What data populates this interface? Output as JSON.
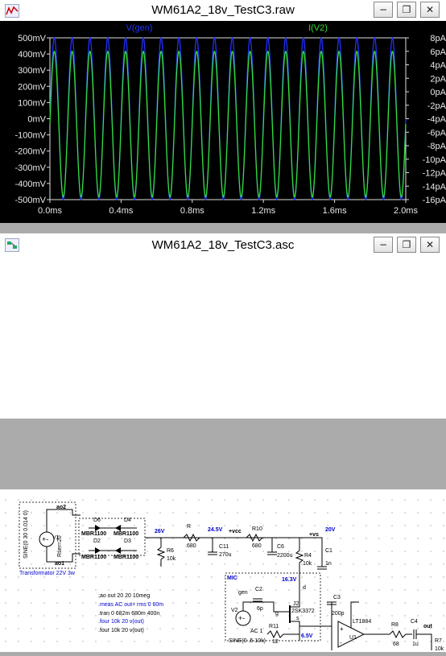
{
  "plot_window": {
    "title": "WM61A2_18v_TestC3.raw",
    "buttons": {
      "minimize": "−",
      "restore": "❐",
      "close": "✕"
    }
  },
  "chart_data": {
    "type": "line",
    "x": {
      "label": "time",
      "range": [
        0,
        2.0
      ],
      "ticks": [
        "0.0ms",
        "0.4ms",
        "0.8ms",
        "1.2ms",
        "1.6ms",
        "2.0ms"
      ]
    },
    "y_left": {
      "range": [
        -500,
        500
      ],
      "ticks": [
        "500mV",
        "400mV",
        "300mV",
        "200mV",
        "100mV",
        "0mV",
        "-100mV",
        "-200mV",
        "-300mV",
        "-400mV",
        "-500mV"
      ]
    },
    "y_right": {
      "range": [
        -16,
        8
      ],
      "ticks": [
        "8pA",
        "6pA",
        "4pA",
        "2pA",
        "0pA",
        "-2pA",
        "-4pA",
        "-6pA",
        "-8pA",
        "-10pA",
        "-12pA",
        "-14pA",
        "-16pA"
      ]
    },
    "series": [
      {
        "name": "V(gen)",
        "color": "#2030ff",
        "amplitude_mV": 500,
        "offset_mV": 0,
        "frequency_kHz": 10,
        "axis": "left"
      },
      {
        "name": "I(V2)",
        "color": "#33dd33",
        "amplitude_pA": 10.8,
        "offset_pA": -4.8,
        "frequency_kHz": 10,
        "axis": "right"
      }
    ],
    "grid": false,
    "background": "#000000"
  },
  "schem_window": {
    "title": "WM61A2_18v_TestC3.asc",
    "buttons": {
      "minimize": "−",
      "restore": "❐",
      "close": "✕"
    }
  },
  "schematic": {
    "transformer": {
      "name": "V1",
      "value": "SINE(0 30 0.014 0)",
      "param": "Rser=20",
      "nodes": [
        "ao2",
        "ao1"
      ],
      "caption": "Transformator 22V 3w"
    },
    "diodes": [
      {
        "name": "D6",
        "part": "MBR1100"
      },
      {
        "name": "D4",
        "part": "MBR1100"
      },
      {
        "name": "D2",
        "part": "MBR1100"
      },
      {
        "name": "D3",
        "part": "MBR1100"
      }
    ],
    "nets": [
      "26V",
      "24.5V",
      "+vcc",
      "20V",
      "+vs",
      "16.3V",
      "6.5V",
      "gen",
      "g",
      "s"
    ],
    "resistors": [
      {
        "name": "R6",
        "value": "10k"
      },
      {
        "name": "R",
        "value": ".680"
      },
      {
        "name": "R10",
        "value": "680"
      },
      {
        "name": "R4",
        "value": "10k"
      },
      {
        "name": "R11",
        "value": "12"
      },
      {
        "name": "R8",
        "value": "68"
      },
      {
        "name": "R7",
        "value": "10k"
      }
    ],
    "capacitors": [
      {
        "name": "C11",
        "value": "270u"
      },
      {
        "name": "C6",
        "value": "2200u"
      },
      {
        "name": "C1",
        "value": "1n"
      },
      {
        "name": "C2",
        "value": "6p"
      },
      {
        "name": "C3",
        "value": "200p"
      },
      {
        "name": "C4",
        "value": "1u"
      }
    ],
    "mic_box": "MIC",
    "jfet": {
      "name": "J2",
      "part": "2SK3372",
      "d": "d"
    },
    "source": {
      "name": "V2",
      "ac": "AC 1",
      "sine": "SINE(0 .5 10k)"
    },
    "opamp": {
      "name": "U1",
      "part": "LT1884"
    },
    "out_label": "out",
    "directives": [
      {
        "text": ";ao out 20 20 10meg",
        "color": "#000000"
      },
      {
        "text": ".meas AC out+ rms 0 60m",
        "color": "#0000cc"
      },
      {
        "text": ".tran 0 682m 680m 400n",
        "color": "#000000"
      },
      {
        "text": ".four 10k 20 v(out)",
        "color": "#0000cc"
      },
      {
        "text": ".four 10k 20 v(out)",
        "color": "#000000"
      }
    ]
  }
}
